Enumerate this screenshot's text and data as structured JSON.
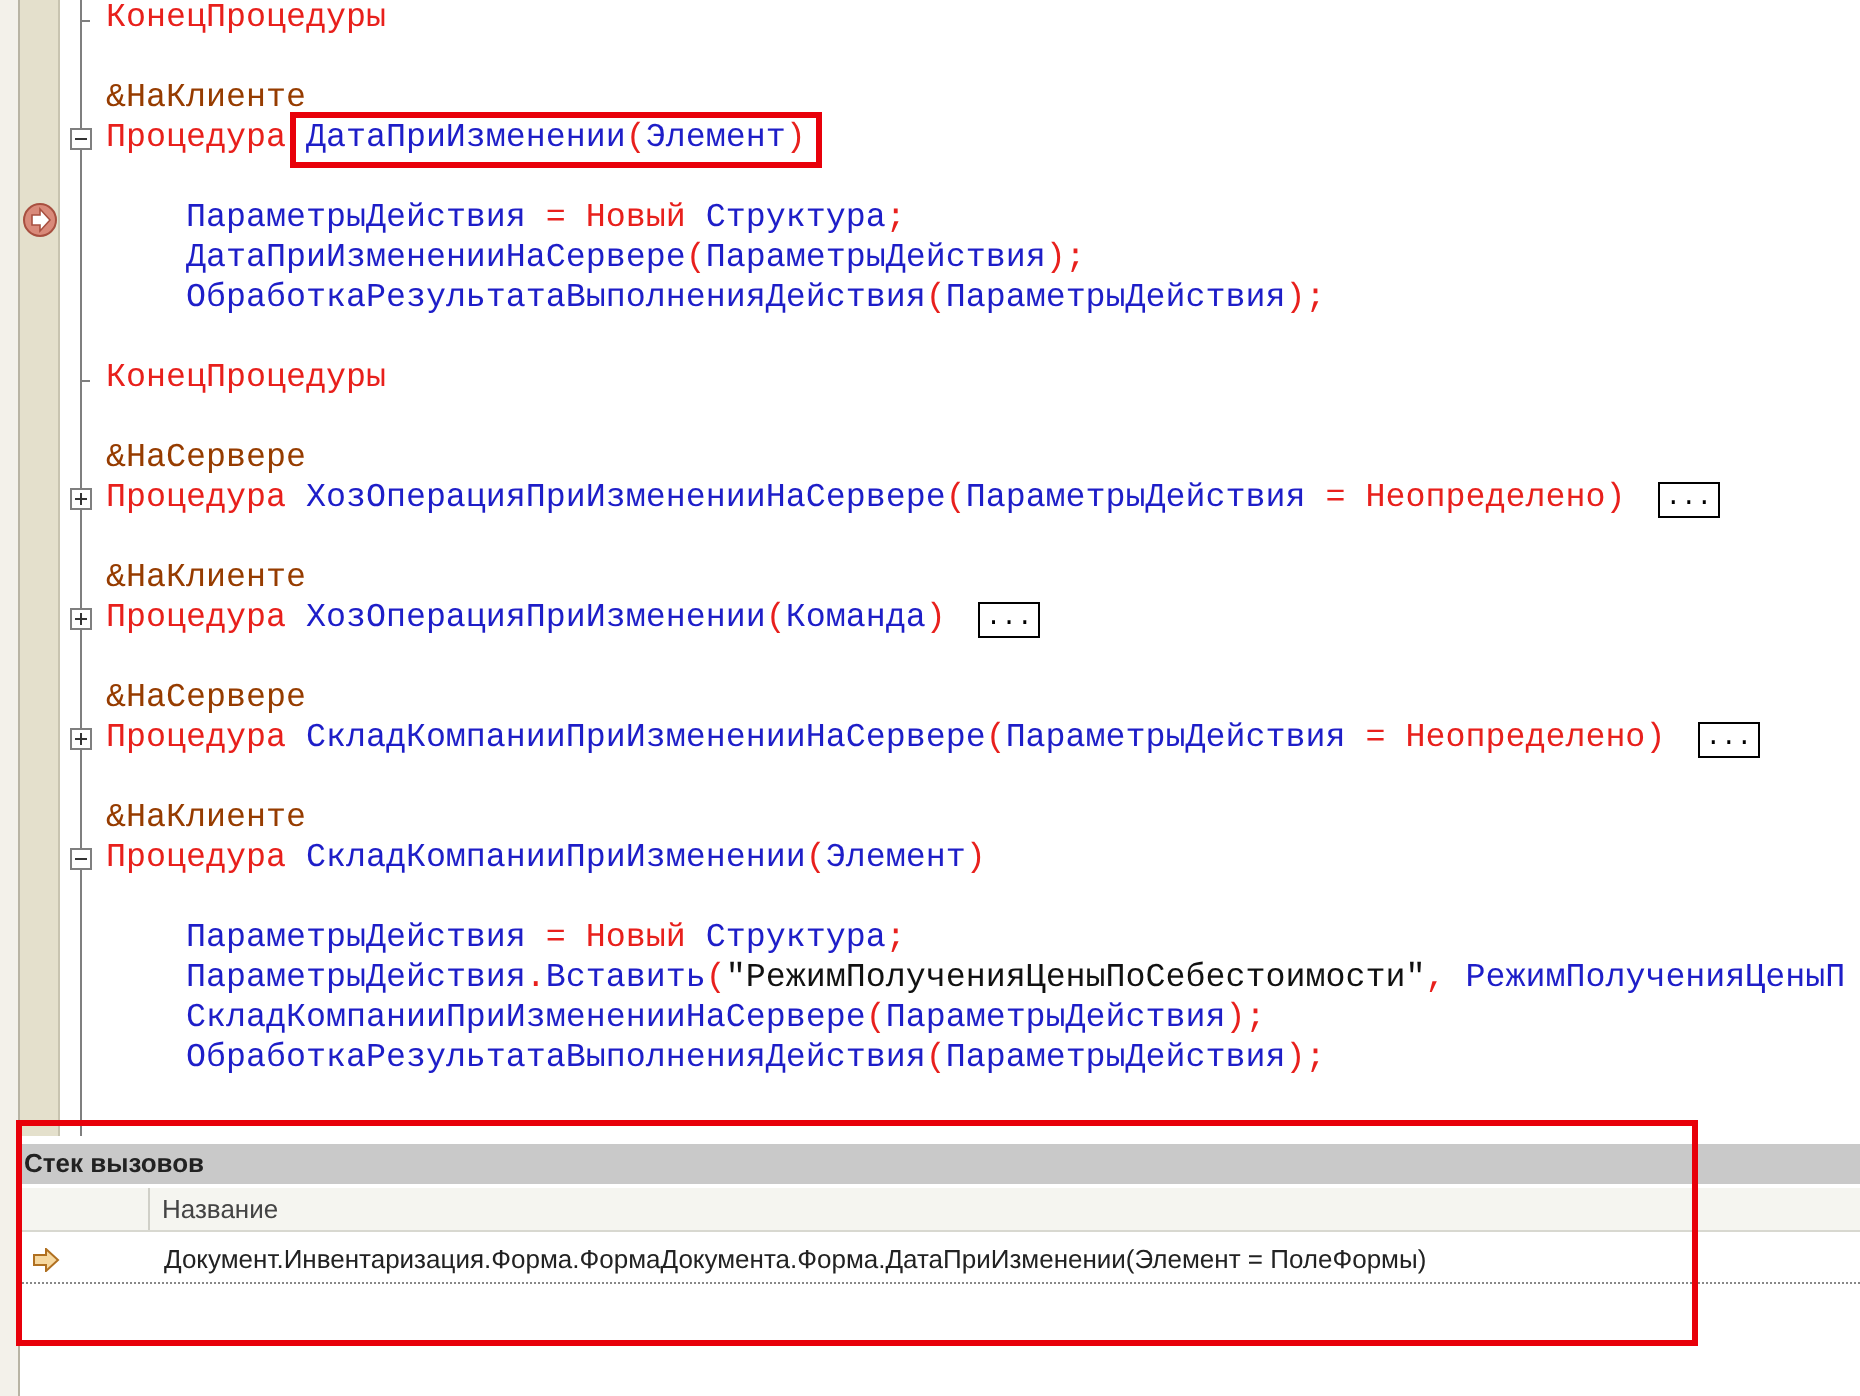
{
  "code_lines": [
    {
      "kind": "end",
      "tokens": [
        {
          "kind": "keyword",
          "text": "КонецПроцедуры"
        }
      ]
    },
    {
      "kind": "blank"
    },
    {
      "kind": "code",
      "tokens": [
        {
          "kind": "directive",
          "text": "&НаКлиенте"
        }
      ]
    },
    {
      "kind": "procedure",
      "collapsed": false,
      "tokens": [
        {
          "kind": "keyword",
          "text": "Процедура "
        },
        {
          "kind": "ident",
          "text": "ДатаПриИзменении",
          "boxed": true
        },
        {
          "kind": "punct",
          "text": "(",
          "boxed": true
        },
        {
          "kind": "ident",
          "text": "Элемент",
          "boxed": true
        },
        {
          "kind": "punct",
          "text": ")",
          "boxed": true
        }
      ],
      "children": [
        {
          "kind": "blank"
        },
        {
          "kind": "code",
          "current": true,
          "tokens": [
            {
              "kind": "ident",
              "text": "ПараметрыДействия"
            },
            {
              "kind": "punct",
              "text": " = "
            },
            {
              "kind": "keyword",
              "text": "Новый"
            },
            {
              "kind": "ident",
              "text": " Структура"
            },
            {
              "kind": "punct",
              "text": ";"
            }
          ]
        },
        {
          "kind": "code",
          "tokens": [
            {
              "kind": "ident",
              "text": "ДатаПриИзмененииНаСервере"
            },
            {
              "kind": "punct",
              "text": "("
            },
            {
              "kind": "ident",
              "text": "ПараметрыДействия"
            },
            {
              "kind": "punct",
              "text": ");"
            }
          ]
        },
        {
          "kind": "code",
          "tokens": [
            {
              "kind": "ident",
              "text": "ОбработкаРезультатаВыполненияДействия"
            },
            {
              "kind": "punct",
              "text": "("
            },
            {
              "kind": "ident",
              "text": "ПараметрыДействия"
            },
            {
              "kind": "punct",
              "text": ");"
            }
          ]
        },
        {
          "kind": "blank"
        }
      ]
    },
    {
      "kind": "end",
      "tokens": [
        {
          "kind": "keyword",
          "text": "КонецПроцедуры"
        }
      ]
    },
    {
      "kind": "blank"
    },
    {
      "kind": "code",
      "tokens": [
        {
          "kind": "directive",
          "text": "&НаСервере"
        }
      ]
    },
    {
      "kind": "procedure",
      "collapsed": true,
      "ellipsis": "...",
      "tokens": [
        {
          "kind": "keyword",
          "text": "Процедура "
        },
        {
          "kind": "ident",
          "text": "ХозОперацияПриИзмененииНаСервере"
        },
        {
          "kind": "punct",
          "text": "("
        },
        {
          "kind": "ident",
          "text": "ПараметрыДействия"
        },
        {
          "kind": "punct",
          "text": " = "
        },
        {
          "kind": "keyword",
          "text": "Неопределено"
        },
        {
          "kind": "punct",
          "text": ")"
        }
      ]
    },
    {
      "kind": "blank"
    },
    {
      "kind": "code",
      "tokens": [
        {
          "kind": "directive",
          "text": "&НаКлиенте"
        }
      ]
    },
    {
      "kind": "procedure",
      "collapsed": true,
      "ellipsis": "...",
      "tokens": [
        {
          "kind": "keyword",
          "text": "Процедура "
        },
        {
          "kind": "ident",
          "text": "ХозОперацияПриИзменении"
        },
        {
          "kind": "punct",
          "text": "("
        },
        {
          "kind": "ident",
          "text": "Команда"
        },
        {
          "kind": "punct",
          "text": ")"
        }
      ]
    },
    {
      "kind": "blank"
    },
    {
      "kind": "code",
      "tokens": [
        {
          "kind": "directive",
          "text": "&НаСервере"
        }
      ]
    },
    {
      "kind": "procedure",
      "collapsed": true,
      "ellipsis": "...",
      "tokens": [
        {
          "kind": "keyword",
          "text": "Процедура "
        },
        {
          "kind": "ident",
          "text": "СкладКомпанииПриИзмененииНаСервере"
        },
        {
          "kind": "punct",
          "text": "("
        },
        {
          "kind": "ident",
          "text": "ПараметрыДействия"
        },
        {
          "kind": "punct",
          "text": " = "
        },
        {
          "kind": "keyword",
          "text": "Неопределено"
        },
        {
          "kind": "punct",
          "text": ")"
        }
      ]
    },
    {
      "kind": "blank"
    },
    {
      "kind": "code",
      "tokens": [
        {
          "kind": "directive",
          "text": "&НаКлиенте"
        }
      ]
    },
    {
      "kind": "procedure",
      "collapsed": false,
      "tokens": [
        {
          "kind": "keyword",
          "text": "Процедура "
        },
        {
          "kind": "ident",
          "text": "СкладКомпанииПриИзменении"
        },
        {
          "kind": "punct",
          "text": "("
        },
        {
          "kind": "ident",
          "text": "Элемент"
        },
        {
          "kind": "punct",
          "text": ")"
        }
      ],
      "children": [
        {
          "kind": "blank"
        },
        {
          "kind": "code",
          "tokens": [
            {
              "kind": "ident",
              "text": "ПараметрыДействия"
            },
            {
              "kind": "punct",
              "text": " = "
            },
            {
              "kind": "keyword",
              "text": "Новый"
            },
            {
              "kind": "ident",
              "text": " Структура"
            },
            {
              "kind": "punct",
              "text": ";"
            }
          ]
        },
        {
          "kind": "code",
          "tokens": [
            {
              "kind": "ident",
              "text": "ПараметрыДействия"
            },
            {
              "kind": "punct",
              "text": "."
            },
            {
              "kind": "ident",
              "text": "Вставить"
            },
            {
              "kind": "punct",
              "text": "("
            },
            {
              "kind": "string",
              "text": "\"РежимПолученияЦеныПоСебестоимости\""
            },
            {
              "kind": "punct",
              "text": ", "
            },
            {
              "kind": "ident",
              "text": "РежимПолученияЦеныП"
            }
          ]
        },
        {
          "kind": "code",
          "tokens": [
            {
              "kind": "ident",
              "text": "СкладКомпанииПриИзмененииНаСервере"
            },
            {
              "kind": "punct",
              "text": "("
            },
            {
              "kind": "ident",
              "text": "ПараметрыДействия"
            },
            {
              "kind": "punct",
              "text": ");"
            }
          ]
        },
        {
          "kind": "code",
          "tokens": [
            {
              "kind": "ident",
              "text": "ОбработкаРезультатаВыполненияДействия"
            },
            {
              "kind": "punct",
              "text": "("
            },
            {
              "kind": "ident",
              "text": "ПараметрыДействия"
            },
            {
              "kind": "punct",
              "text": ");"
            }
          ]
        },
        {
          "kind": "blank"
        }
      ]
    }
  ],
  "call_stack": {
    "title": "Стек вызовов",
    "highlighted": true,
    "column": "Название",
    "rows": [
      {
        "text": "Документ.Инвентаризация.Форма.ФормаДокумента.Форма.ДатаПриИзменении(Элемент = ПолеФормы)",
        "current": true
      }
    ]
  }
}
